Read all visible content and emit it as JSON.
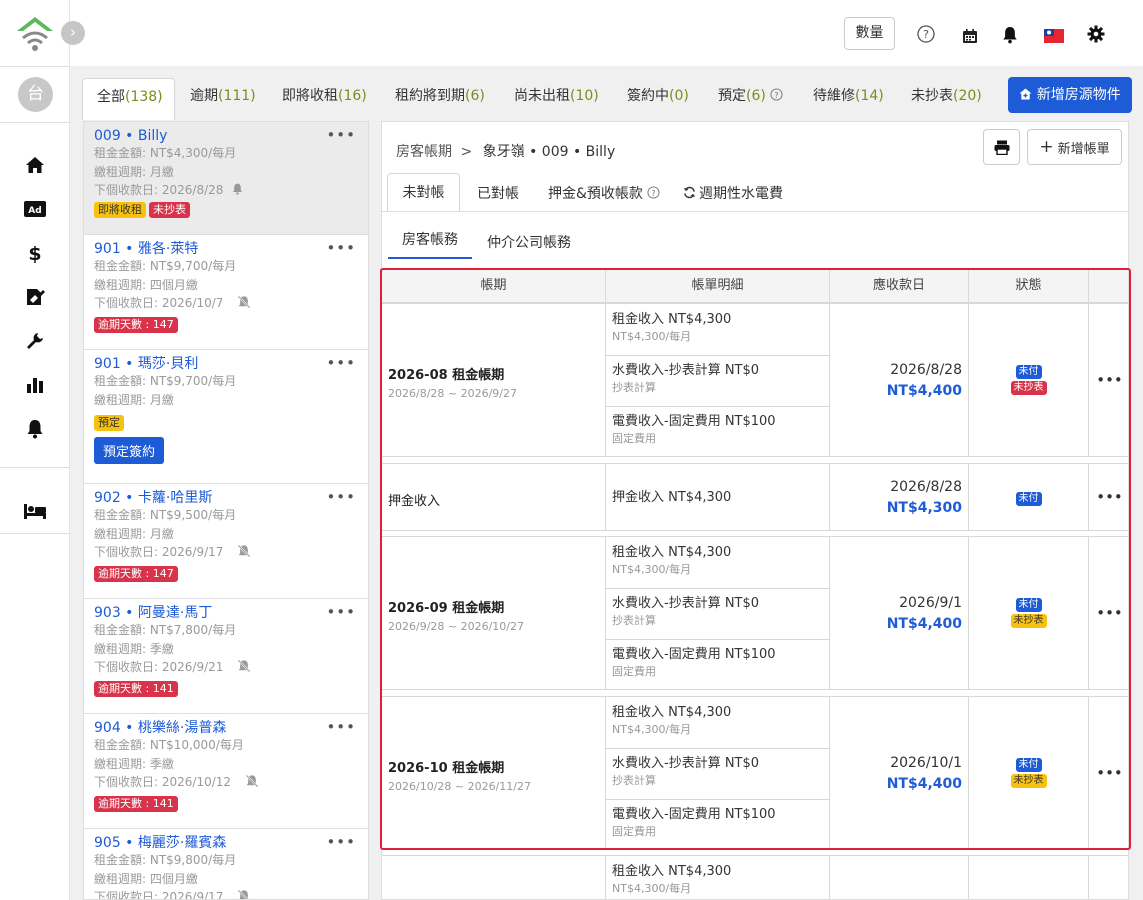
{
  "sidebar": {
    "avatar_text": "台",
    "nav": [
      {
        "icon": "home-icon"
      },
      {
        "icon": "ad-icon"
      },
      {
        "icon": "dollar-icon"
      },
      {
        "icon": "signature-icon"
      },
      {
        "icon": "wrench-icon"
      },
      {
        "icon": "bar-chart-icon"
      },
      {
        "icon": "bell-icon"
      },
      {
        "icon": "bed-icon"
      }
    ]
  },
  "topbar": {
    "qty_label": "數量",
    "icons": [
      "help-icon",
      "calendar-icon",
      "bell-icon",
      "taiwan-flag-icon",
      "gear-icon"
    ]
  },
  "tabs": [
    {
      "label": "全部",
      "count": "(138)"
    },
    {
      "label": "逾期",
      "count": "(111)"
    },
    {
      "label": "即將收租",
      "count": "(16)"
    },
    {
      "label": "租約將到期",
      "count": "(6)"
    },
    {
      "label": "尚未出租",
      "count": "(10)"
    },
    {
      "label": "簽約中",
      "count": "(0)"
    },
    {
      "label": "預定",
      "count": "(6)"
    },
    {
      "label": "待維修",
      "count": "(14)"
    },
    {
      "label": "未抄表",
      "count": "(20)"
    }
  ],
  "add_property_label": "新增房源物件",
  "properties": [
    {
      "title": "009 • Billy",
      "rent": "租金金額: NT$4,300/每月",
      "cycle": "繳租週期: 月繳",
      "next": "下個收款日: 2026/8/28",
      "badges": [
        {
          "text": "即將收租",
          "type": "yellow"
        },
        {
          "text": "未抄表",
          "type": "red"
        }
      ]
    },
    {
      "title": "901 • 雅各·萊特",
      "rent": "租金金額: NT$9,700/每月",
      "cycle": "繳租週期: 四個月繳",
      "next": "下個收款日: 2026/10/7",
      "badges": [
        {
          "text": "逾期天數 : 147",
          "type": "red"
        }
      ]
    },
    {
      "title": "901 • 瑪莎·貝利",
      "rent": "租金金額: NT$9,700/每月",
      "cycle": "繳租週期: 月繳",
      "badges": [
        {
          "text": "預定",
          "type": "yellow"
        }
      ],
      "button": "預定簽約"
    },
    {
      "title": "902 • 卡蘿·哈里斯",
      "rent": "租金金額: NT$9,500/每月",
      "cycle": "繳租週期: 月繳",
      "next": "下個收款日: 2026/9/17",
      "badges": [
        {
          "text": "逾期天數 : 147",
          "type": "red"
        }
      ]
    },
    {
      "title": "903 • 阿曼達·馬丁",
      "rent": "租金金額: NT$7,800/每月",
      "cycle": "繳租週期: 季繳",
      "next": "下個收款日: 2026/9/21",
      "badges": [
        {
          "text": "逾期天數 : 141",
          "type": "red"
        }
      ]
    },
    {
      "title": "904 • 桃樂絲·湯普森",
      "rent": "租金金額: NT$10,000/每月",
      "cycle": "繳租週期: 季繳",
      "next": "下個收款日: 2026/10/12",
      "badges": [
        {
          "text": "逾期天數 : 141",
          "type": "red"
        }
      ]
    },
    {
      "title": "905 • 梅麗莎·羅賓森",
      "rent": "租金金額: NT$9,800/每月",
      "cycle": "繳租週期: 四個月繳",
      "next": "下個收款日: 2026/9/17",
      "badges": []
    }
  ],
  "detail": {
    "breadcrumb": [
      "房客帳期",
      "象牙嶺 • 009 • Billy"
    ],
    "breadcrumb_sep": ">",
    "add_bill_label": "新增帳單",
    "tabs": [
      "未對帳",
      "已對帳",
      "押金&預收帳款",
      "週期性水電費"
    ],
    "subtabs": [
      "房客帳務",
      "仲介公司帳務"
    ],
    "columns": [
      "帳期",
      "帳單明細",
      "應收款日",
      "狀態"
    ],
    "more": "•••",
    "groups": [
      {
        "period": "2026-08 租金帳期",
        "range": "2026/8/28 ~ 2026/9/27",
        "items": [
          {
            "t": "租金收入  NT$4,300",
            "s": "NT$4,300/每月"
          },
          {
            "t": "水費收入-抄表計算  NT$0",
            "s": "抄表計算"
          },
          {
            "t": "電費收入-固定費用  NT$100",
            "s": "固定費用"
          }
        ],
        "date": "2026/8/28",
        "amount": "NT$4,400",
        "status": [
          {
            "text": "未付",
            "type": "blue"
          },
          {
            "text": "未抄表",
            "type": "red"
          }
        ]
      },
      {
        "period": "押金收入",
        "range": "",
        "items": [
          {
            "t": "押金收入  NT$4,300",
            "s": ""
          }
        ],
        "date": "2026/8/28",
        "amount": "NT$4,300",
        "status": [
          {
            "text": "未付",
            "type": "blue"
          }
        ]
      },
      {
        "period": "2026-09 租金帳期",
        "range": "2026/9/28 ~ 2026/10/27",
        "items": [
          {
            "t": "租金收入  NT$4,300",
            "s": "NT$4,300/每月"
          },
          {
            "t": "水費收入-抄表計算  NT$0",
            "s": "抄表計算"
          },
          {
            "t": "電費收入-固定費用  NT$100",
            "s": "固定費用"
          }
        ],
        "date": "2026/9/1",
        "amount": "NT$4,400",
        "status": [
          {
            "text": "未付",
            "type": "blue"
          },
          {
            "text": "未抄表",
            "type": "yellow"
          }
        ]
      },
      {
        "period": "2026-10 租金帳期",
        "range": "2026/10/28 ~ 2026/11/27",
        "items": [
          {
            "t": "租金收入  NT$4,300",
            "s": "NT$4,300/每月"
          },
          {
            "t": "水費收入-抄表計算  NT$0",
            "s": "抄表計算"
          },
          {
            "t": "電費收入-固定費用  NT$100",
            "s": "固定費用"
          }
        ],
        "date": "2026/10/1",
        "amount": "NT$4,400",
        "status": [
          {
            "text": "未付",
            "type": "blue"
          },
          {
            "text": "未抄表",
            "type": "yellow"
          }
        ]
      },
      {
        "period": "",
        "range": "",
        "items": [
          {
            "t": "租金收入  NT$4,300",
            "s": "NT$4,300/每月"
          }
        ],
        "date": "",
        "amount": "",
        "status": []
      }
    ]
  },
  "colors": {
    "accent": "#1e5bd6",
    "danger": "#d8334a",
    "warning": "#f6c20f",
    "highlight_frame": "#e0203a",
    "count": "#7a8c1d"
  }
}
